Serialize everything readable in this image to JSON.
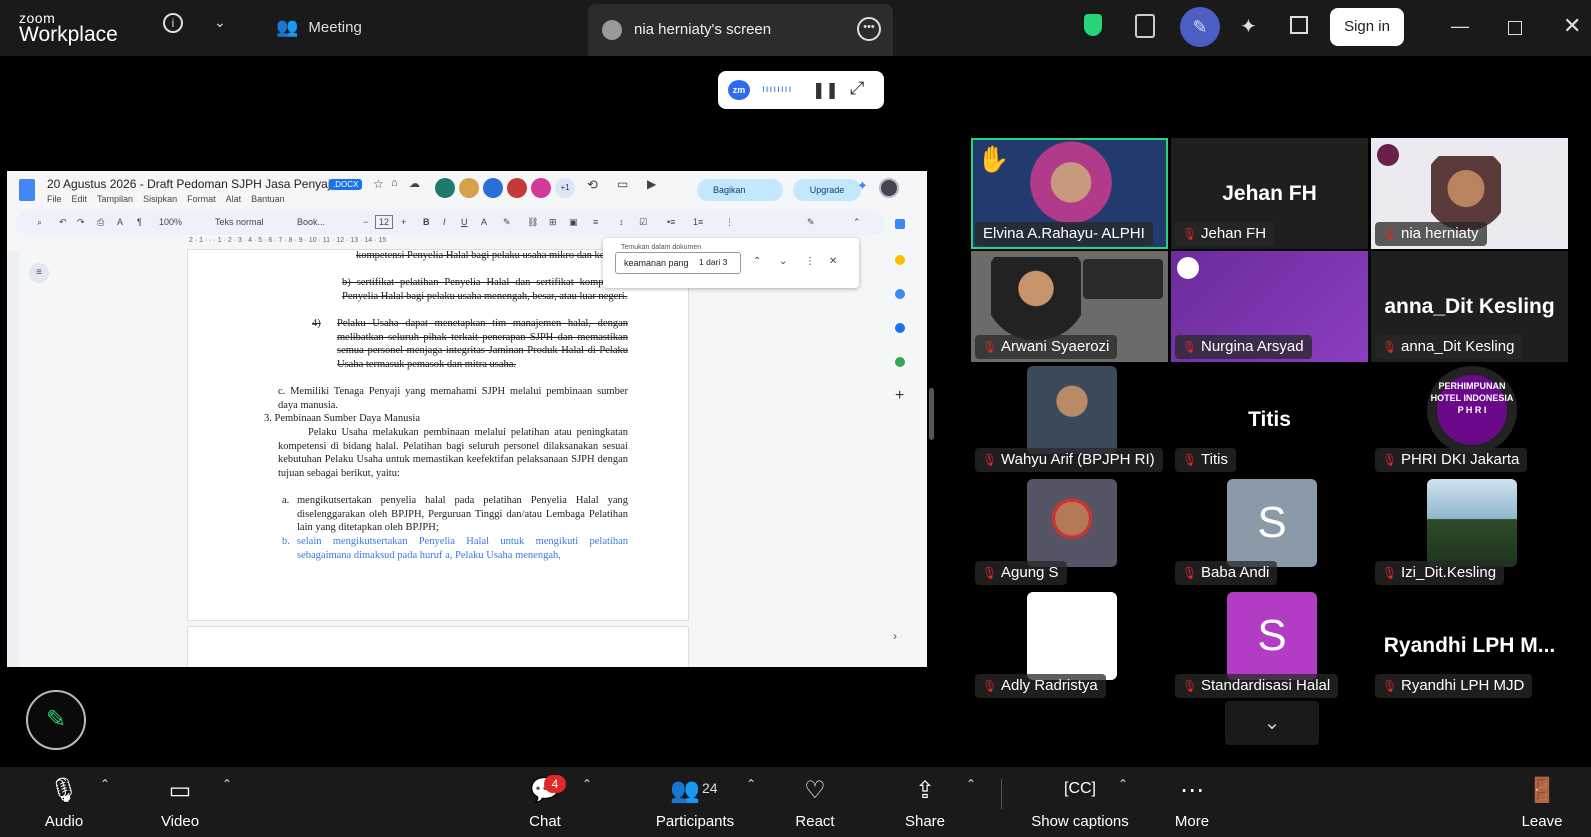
{
  "app": {
    "logo_line1": "zoom",
    "logo_line2": "Workplace",
    "meeting_label": "Meeting",
    "share_tab_label": "nia herniaty's screen",
    "sign_in": "Sign in"
  },
  "share_control": {
    "zm": "zm",
    "bars": "ıııııııı"
  },
  "doc": {
    "title": "20 Agustus 2026 - Draft Pedoman SJPH Jasa Penyaj...",
    "badge": ".DOCX",
    "menu": [
      "File",
      "Edit",
      "Tampilan",
      "Sisipkan",
      "Format",
      "Alat",
      "Bantuan"
    ],
    "collab_count": "+1",
    "share_btn": "Bagikan",
    "upgrade_btn": "Upgrade",
    "toolbar": {
      "zoom": "100%",
      "style": "Teks normal",
      "font": "Book...",
      "size": "12"
    },
    "ruler": "2 · 1 · · · 1 · 2 · 3 · 4 · 5 · 6 · 7 · 8 · 9 · 10 · 11 · 12 · 13 · 14 · 15",
    "find": {
      "hint": "Temukan dalam dokumen",
      "query": "keamanan pang",
      "count": "1 dari 3"
    },
    "lines": {
      "l1": "kompetensi Penyelia Halal bagi pelaku usaha mikro dan kecil;",
      "l2": "b) sertifikat pelatihan Penyelia Halal dan sertifikat kompetensi Penyelia Halal bagi pelaku usaha menengah, besar, atau luar negeri.",
      "l3_num": "4)",
      "l3": "Pelaku Usaha dapat menetapkan tim manajemen halal, dengan melibatkan seluruh pihak terkait penerapan SJPH dan memastikan semua personel menjaga integritas Jaminan Produk Halal di Pelaku Usaha termasuk pemasok dan mitra usaha.",
      "c": "c.  Memiliki Tenaga Penyaji yang memahami SJPH melalui pembinaan sumber daya manusia.",
      "h3": "3.  Pembinaan Sumber Daya Manusia",
      "para": "Pelaku Usaha melakukan pembinaan melalui pelatihan atau peningkatan kompetensi di bidang halal. Pelatihan bagi seluruh personel dilaksanakan sesuai kebutuhan Pelaku Usaha untuk memastikan keefektifan pelaksanaan SJPH dengan tujuan sebagai berikut, yaitu:",
      "a_num": "a.",
      "a": "mengikutsertakan penyelia halal pada pelatihan Penyelia Halal yang diselenggarakan oleh BPJPH, Perguruan Tinggi dan/atau Lembaga Pelatihan lain yang ditetapkan oleh BPJPH;",
      "b_num": "b.",
      "b": "selain mengikutsertakan Penyelia Halal untuk mengikuti pelatihan sebagaimana dimaksud pada huruf a, Pelaku Usaha menengah,"
    }
  },
  "participants": [
    {
      "name": "Elvina A.Rahayu- ALPHI",
      "muted": false,
      "kind": "video",
      "active": true,
      "hand": true
    },
    {
      "name": "Jehan FH",
      "muted": true,
      "kind": "text",
      "big": "Jehan FH"
    },
    {
      "name": "nia herniaty",
      "muted": true,
      "kind": "video"
    },
    {
      "name": "Arwani Syaerozi",
      "muted": true,
      "kind": "video"
    },
    {
      "name": "Nurgina Arsyad",
      "muted": true,
      "kind": "video"
    },
    {
      "name": "anna_Dit Kesling",
      "muted": true,
      "kind": "text",
      "big": "anna_Dit Kesling"
    },
    {
      "name": "Wahyu Arif (BPJPH RI)",
      "muted": true,
      "kind": "photo"
    },
    {
      "name": "Titis",
      "muted": true,
      "kind": "text",
      "big": "Titis"
    },
    {
      "name": "PHRI DKI Jakarta",
      "muted": true,
      "kind": "photo"
    },
    {
      "name": "Agung S",
      "muted": true,
      "kind": "photo"
    },
    {
      "name": "Baba Andi",
      "muted": true,
      "kind": "letter",
      "letter": "S"
    },
    {
      "name": "Izi_Dit.Kesling",
      "muted": true,
      "kind": "photo"
    },
    {
      "name": "Adly Radristya",
      "muted": true,
      "kind": "photo"
    },
    {
      "name": "Standardisasi Halal",
      "muted": true,
      "kind": "letter",
      "letter": "S"
    },
    {
      "name": "Ryandhi LPH MJD",
      "muted": true,
      "kind": "text",
      "big": "Ryandhi LPH M..."
    }
  ],
  "logo_text": {
    "phri": "PERHIMPUNAN HOTEL INDONESIA P H R I"
  },
  "bottom": {
    "audio": "Audio",
    "video": "Video",
    "chat": "Chat",
    "chat_badge": "4",
    "participants": "Participants",
    "participants_count": "24",
    "react": "React",
    "share": "Share",
    "captions": "Show captions",
    "more": "More",
    "leave": "Leave"
  },
  "colors": {
    "accent": "#27d47a",
    "muted_red": "#e02828",
    "zoom_blue": "#2d6cf0"
  }
}
